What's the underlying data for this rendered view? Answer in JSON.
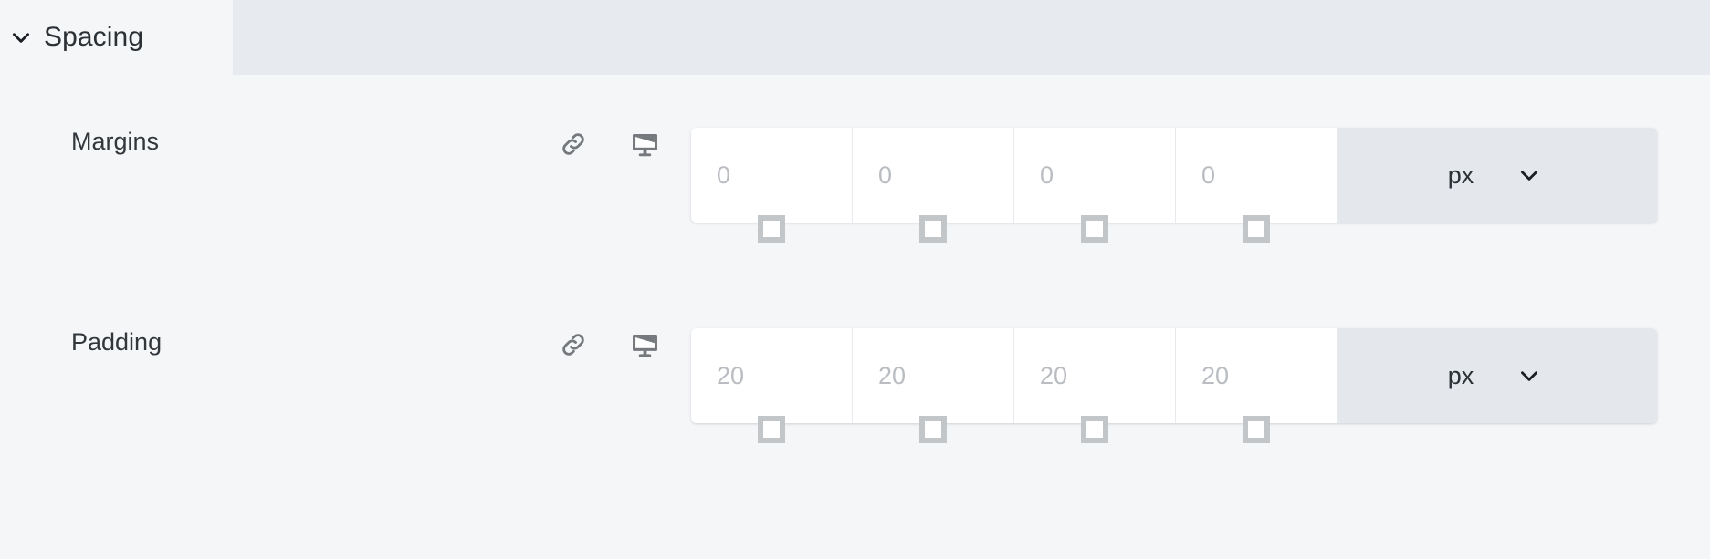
{
  "panel": {
    "section": {
      "title": "Spacing",
      "collapse_icon": "chevron-down-icon",
      "expanded": true
    },
    "rows": [
      {
        "id": "margins",
        "label": "Margins",
        "link_icon": "link-icon",
        "device_icon": "desktop-icon",
        "fields": [
          {
            "side": "top",
            "value": "",
            "placeholder": "0"
          },
          {
            "side": "right",
            "value": "",
            "placeholder": "0"
          },
          {
            "side": "bottom",
            "value": "",
            "placeholder": "0"
          },
          {
            "side": "left",
            "value": "",
            "placeholder": "0"
          }
        ],
        "unit": {
          "value": "px",
          "chevron_icon": "chevron-down-icon"
        },
        "side_marks": [
          "box-top-icon",
          "box-right-icon",
          "box-bottom-icon",
          "box-left-icon"
        ]
      },
      {
        "id": "padding",
        "label": "Padding",
        "link_icon": "link-icon",
        "device_icon": "desktop-icon",
        "fields": [
          {
            "side": "top",
            "value": "",
            "placeholder": "20"
          },
          {
            "side": "right",
            "value": "",
            "placeholder": "20"
          },
          {
            "side": "bottom",
            "value": "",
            "placeholder": "20"
          },
          {
            "side": "left",
            "value": "",
            "placeholder": "20"
          }
        ],
        "unit": {
          "value": "px",
          "chevron_icon": "chevron-down-icon"
        },
        "side_marks": [
          "box-top-icon",
          "box-right-icon",
          "box-bottom-icon",
          "box-left-icon"
        ]
      }
    ],
    "colors": {
      "background": "#f4f6f8",
      "header_band": "#e7eaee",
      "field_background": "#ffffff",
      "unit_background": "#e4e8ed",
      "text": "#32373c",
      "placeholder": "#b9bdc2",
      "icon": "#75797d",
      "side_mark": "#c3c6c9"
    }
  }
}
